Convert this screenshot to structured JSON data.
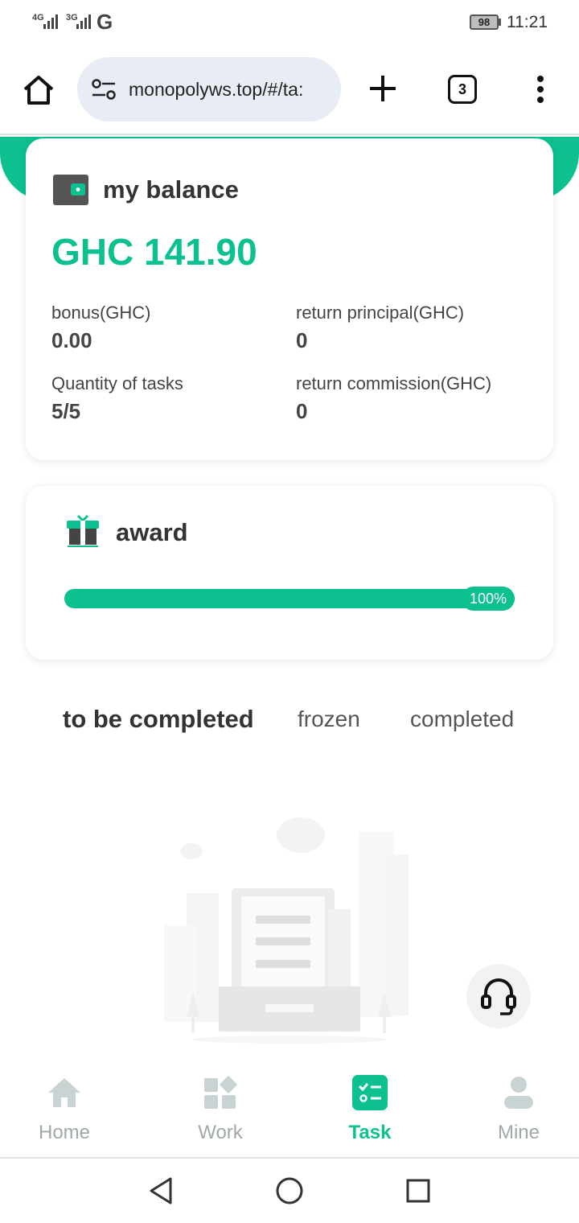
{
  "status_bar": {
    "signal1": "4G",
    "signal2": "3G",
    "carrier_icon": "G",
    "battery": "98",
    "time": "11:21"
  },
  "browser": {
    "url": "monopolyws.top/#/ta:",
    "tab_count": "3",
    "icons": [
      "home-icon",
      "site-settings-icon",
      "new-tab-icon",
      "tabs-icon",
      "more-menu-icon"
    ]
  },
  "balance_card": {
    "title": "my balance",
    "amount": "GHC 141.90",
    "stats": [
      {
        "label": "bonus(GHC)",
        "value": "0.00"
      },
      {
        "label": "return principal(GHC)",
        "value": "0"
      },
      {
        "label": "Quantity of tasks",
        "value": "5/5"
      },
      {
        "label": "return commission(GHC)",
        "value": "0"
      }
    ]
  },
  "award_card": {
    "title": "award",
    "progress_percent": 100,
    "progress_label": "100%"
  },
  "tabs": [
    "to be completed",
    "frozen",
    "completed"
  ],
  "bottom_nav": [
    {
      "label": "Home",
      "icon": "home-icon"
    },
    {
      "label": "Work",
      "icon": "grid-icon"
    },
    {
      "label": "Task",
      "icon": "task-list-icon",
      "active": true
    },
    {
      "label": "Mine",
      "icon": "user-icon"
    }
  ],
  "colors": {
    "accent": "#0cc08f",
    "inactive": "#a0a8ab"
  }
}
